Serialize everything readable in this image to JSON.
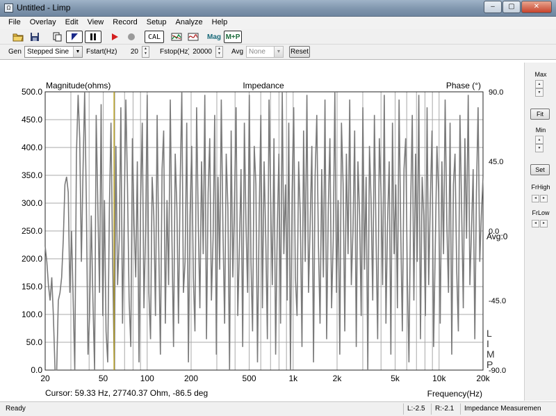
{
  "window": {
    "title": "Untitled - Limp",
    "minimize_glyph": "‒",
    "maximize_glyph": "▢",
    "close_glyph": "✕"
  },
  "menu": [
    "File",
    "Overlay",
    "Edit",
    "View",
    "Record",
    "Setup",
    "Analyze",
    "Help"
  ],
  "toolbar": {
    "icons": [
      "open-folder-icon",
      "save-disk-icon",
      "copy-icon",
      "play-step-icon",
      "pause-icon",
      "record-icon",
      "stop-icon",
      "cal-button",
      "overlay-icon",
      "curve-icon",
      "mag-button",
      "mag-phase-button"
    ],
    "cal_label": "CAL",
    "mag_label": "Mag",
    "mp_label": "M+P"
  },
  "generator": {
    "gen_label": "Gen",
    "gen_mode": "Stepped Sine",
    "fstart_label": "Fstart(Hz)",
    "fstart_value": "20",
    "fstop_label": "Fstop(Hz)",
    "fstop_value": "20000",
    "avg_label": "Avg",
    "avg_value": "None",
    "reset_label": "Reset"
  },
  "chart_data": {
    "type": "line",
    "title": "Impedance",
    "ylabel_left": "Magnitude(ohms)",
    "ylabel_right": "Phase (°)",
    "xlabel": "Frequency(Hz)",
    "x_scale": "log",
    "xlim": [
      20,
      20000
    ],
    "ylim_left": [
      0,
      500
    ],
    "ylim_right": [
      -90,
      90
    ],
    "y_ticks_left": [
      "0.0",
      "50.0",
      "100.0",
      "150.0",
      "200.0",
      "250.0",
      "300.0",
      "350.0",
      "400.0",
      "450.0",
      "500.0"
    ],
    "y_ticks_right": [
      "90.0",
      "45.0",
      "0.0",
      "-45.0",
      "-90.0"
    ],
    "x_ticks": [
      "20",
      "50",
      "100",
      "200",
      "500",
      "1k",
      "2k",
      "5k",
      "10k",
      "20k"
    ],
    "avg_text": "Avg:0",
    "watermark": "LIMP",
    "cursor_x": 59.33,
    "cursor_color": "#b8a020",
    "trace_color": "#7a7a7a",
    "grid": "on",
    "series": [
      {
        "values_phase_deg": [
          -10,
          -20,
          -35,
          -45,
          -30,
          -55,
          -90,
          -90,
          -45,
          -40,
          -30,
          -5,
          30,
          35,
          25,
          -40,
          0,
          -45,
          -90,
          50,
          88,
          60,
          -20,
          40,
          90,
          20,
          -80,
          -55,
          10,
          -45,
          -90,
          75,
          15,
          -40,
          82,
          -55,
          20,
          -65,
          -85,
          15,
          70,
          -20,
          -90,
          55,
          -35,
          -5,
          80,
          -60,
          10,
          85,
          30,
          -45,
          -75,
          60,
          5,
          -30,
          45,
          -85,
          20,
          70,
          -50,
          0,
          88,
          -40,
          -70,
          35,
          10,
          -55,
          75,
          -10,
          -80,
          40,
          65,
          -60,
          20,
          -35,
          85,
          -5,
          -75,
          50,
          15,
          -60,
          30,
          90,
          -40,
          -20,
          70,
          -85,
          10,
          55,
          -30,
          -65,
          80,
          5,
          -50,
          45,
          -15,
          88,
          -70,
          25,
          60,
          -45,
          -5,
          75,
          -80,
          35,
          -25,
          85,
          0,
          -60,
          50,
          15,
          -90,
          65,
          -30,
          20,
          80,
          -55,
          -10,
          40,
          -75,
          70,
          5,
          -40,
          88,
          -20,
          -65,
          55,
          30,
          -85,
          10,
          75,
          -50,
          45,
          -5,
          -70,
          85,
          20,
          -35,
          60,
          -80,
          0,
          50,
          -60,
          90,
          -15,
          30,
          -45,
          70,
          -90,
          25,
          80,
          -30,
          -55,
          45,
          10,
          -75,
          65,
          -20,
          88,
          -40,
          5,
          55,
          -85,
          35,
          75,
          -10,
          -60,
          40,
          -30,
          85,
          -70,
          15,
          60,
          -50,
          -5,
          90,
          -40,
          20,
          -80,
          70,
          30,
          -65,
          50,
          -15,
          85,
          -35,
          0,
          65,
          -75,
          45,
          10,
          -55,
          80,
          -25,
          35,
          -90,
          55,
          20,
          -45,
          75,
          -5,
          -70,
          60,
          25,
          -35,
          88,
          -60,
          5,
          45,
          -80,
          70,
          -15,
          30,
          -50,
          85,
          0,
          -65,
          40,
          60,
          -30,
          -85,
          15,
          75,
          -45,
          50,
          -20,
          88,
          -70,
          35,
          10,
          -55,
          80,
          -35,
          20,
          65,
          -75,
          -10,
          55,
          25,
          -60,
          45,
          -15,
          85,
          5,
          -40,
          70,
          -80,
          30,
          50,
          -25,
          -65,
          75,
          15,
          -50,
          60,
          -5,
          88,
          -35,
          0,
          40,
          -70,
          25,
          80,
          -20,
          10,
          35
        ]
      }
    ]
  },
  "sidepanel": {
    "max_label": "Max",
    "fit_label": "Fit",
    "min_label": "Min",
    "set_label": "Set",
    "frhigh_label": "FrHigh",
    "frlow_label": "FrLow"
  },
  "cursor_readout": "Cursor: 59.33 Hz, 27740.37 Ohm, -86.5 deg",
  "status": {
    "ready": "Ready",
    "left_level": "L:-2.5",
    "right_level": "R:-2.1",
    "mode": "Impedance Measuremen"
  }
}
